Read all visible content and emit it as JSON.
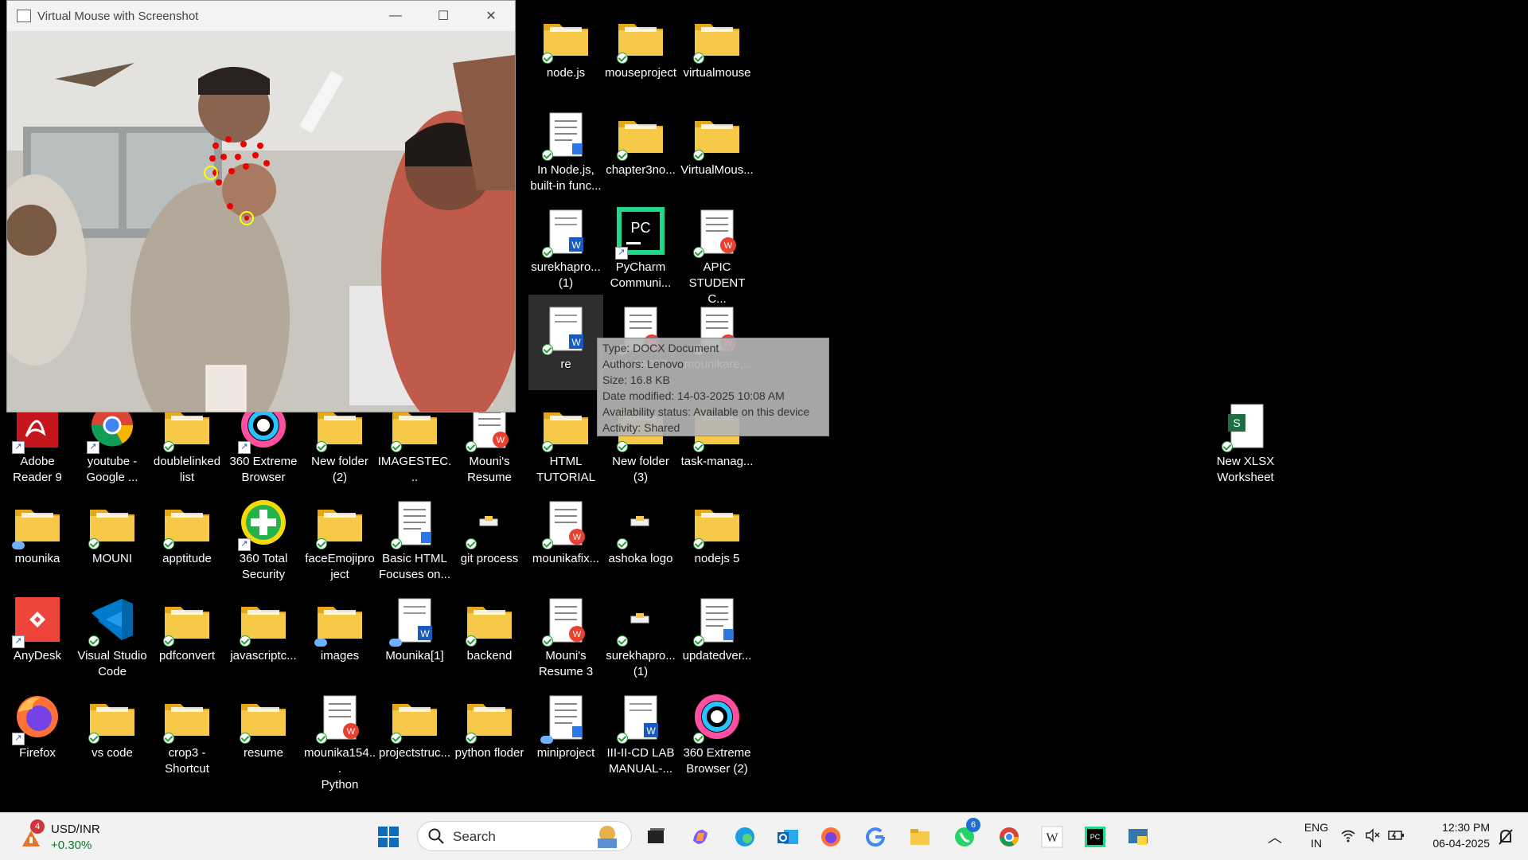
{
  "window": {
    "title": "Virtual Mouse with Screenshot",
    "minimize": "—",
    "maximize": "☐",
    "close": "✕"
  },
  "desktop_icons": [
    {
      "id": "nodejs",
      "label": "node.js",
      "type": "folder"
    },
    {
      "id": "mouseproject",
      "label": "mouseproject",
      "type": "folder"
    },
    {
      "id": "virtualmouse",
      "label": "virtualmouse",
      "type": "folder"
    },
    {
      "id": "innodejs",
      "label": "In Node.js,\nbuilt-in func...",
      "type": "doc"
    },
    {
      "id": "chapter3",
      "label": "chapter3no...",
      "type": "folder"
    },
    {
      "id": "virtualmous2",
      "label": "VirtualMous...",
      "type": "folder"
    },
    {
      "id": "surekha1",
      "label": "surekhapro...\n(1)",
      "type": "word"
    },
    {
      "id": "pycharm",
      "label": "PyCharm\nCommuni...",
      "type": "pycharm"
    },
    {
      "id": "apic",
      "label": "APIC\nSTUDENT C...",
      "type": "wps"
    },
    {
      "id": "re",
      "label": "re",
      "type": "word"
    },
    {
      "id": "r2221",
      "label": "2221 1A052...",
      "type": "wps"
    },
    {
      "id": "mounikare",
      "label": "mounikare...",
      "type": "wps"
    },
    {
      "id": "adobe",
      "label": "Adobe\nReader 9",
      "type": "adobe"
    },
    {
      "id": "youtube",
      "label": "youtube -\nGoogle ...",
      "type": "chrome"
    },
    {
      "id": "doublelinked",
      "label": "doublelinked\nlist",
      "type": "folder"
    },
    {
      "id": "extreme360",
      "label": "360 Extreme\nBrowser",
      "type": "ring"
    },
    {
      "id": "newfolder2",
      "label": "New folder\n(2)",
      "type": "folder"
    },
    {
      "id": "imagestec",
      "label": "IMAGESTEC...",
      "type": "folder"
    },
    {
      "id": "mounisresume",
      "label": "Mouni's\nResume",
      "type": "wps"
    },
    {
      "id": "htmltut",
      "label": "HTML\nTUTORIAL",
      "type": "folder"
    },
    {
      "id": "newfolder3",
      "label": "New folder\n(3)",
      "type": "folder"
    },
    {
      "id": "taskmanag",
      "label": "task-manag...",
      "type": "folder"
    },
    {
      "id": "newxlsx",
      "label": "New XLSX\nWorksheet",
      "type": "excel"
    },
    {
      "id": "mounika",
      "label": "mounika",
      "type": "folder"
    },
    {
      "id": "mouni",
      "label": "MOUNI",
      "type": "folder"
    },
    {
      "id": "apptitude",
      "label": "apptitude",
      "type": "folder"
    },
    {
      "id": "total360",
      "label": "360 Total\nSecurity",
      "type": "plus"
    },
    {
      "id": "faceemoji",
      "label": "faceEmojipro\nject",
      "type": "folder"
    },
    {
      "id": "basichtml",
      "label": "Basic HTML\nFocuses on...",
      "type": "doc"
    },
    {
      "id": "gitprocess",
      "label": "git process",
      "type": "small"
    },
    {
      "id": "mounikafix",
      "label": "mounikafix...",
      "type": "wps"
    },
    {
      "id": "ashoka",
      "label": "ashoka logo",
      "type": "small"
    },
    {
      "id": "nodejs5",
      "label": "nodejs 5",
      "type": "folder"
    },
    {
      "id": "anydesk",
      "label": "AnyDesk",
      "type": "anydesk"
    },
    {
      "id": "vscode",
      "label": "Visual Studio\nCode",
      "type": "vscode"
    },
    {
      "id": "pdfconvert",
      "label": "pdfconvert",
      "type": "folder"
    },
    {
      "id": "javascriptc",
      "label": "javascriptc...",
      "type": "folder"
    },
    {
      "id": "images",
      "label": "images",
      "type": "folder"
    },
    {
      "id": "mounika1",
      "label": "Mounika[1]",
      "type": "word"
    },
    {
      "id": "backend",
      "label": "backend",
      "type": "folder"
    },
    {
      "id": "mounisresume3",
      "label": "Mouni's\nResume 3",
      "type": "wps"
    },
    {
      "id": "surekha1b",
      "label": "surekhapro...\n(1)",
      "type": "small"
    },
    {
      "id": "updatedver",
      "label": "updatedver...",
      "type": "doc"
    },
    {
      "id": "firefox",
      "label": "Firefox",
      "type": "firefox"
    },
    {
      "id": "vscodefolder",
      "label": "vs code",
      "type": "folder"
    },
    {
      "id": "crop3",
      "label": "crop3 -\nShortcut",
      "type": "folder"
    },
    {
      "id": "resume",
      "label": "resume",
      "type": "folder"
    },
    {
      "id": "mounika154",
      "label": "mounika154...\nPython",
      "type": "wps"
    },
    {
      "id": "projectstruc",
      "label": "projectstruc...",
      "type": "folder"
    },
    {
      "id": "pythonfloder",
      "label": "python floder",
      "type": "folder"
    },
    {
      "id": "miniproject",
      "label": "miniproject",
      "type": "doc"
    },
    {
      "id": "labmanual",
      "label": "III-II-CD LAB\nMANUAL-...",
      "type": "word"
    },
    {
      "id": "extreme360b",
      "label": "360 Extreme\nBrowser (2)",
      "type": "ring"
    }
  ],
  "tooltip": {
    "type": "Type: DOCX Document",
    "authors": "Authors: Lenovo",
    "size": "Size: 16.8 KB",
    "modified": "Date modified: 14-03-2025 10:08 AM",
    "availability": "Availability status: Available on this device",
    "activity": "Activity: Shared"
  },
  "taskbar": {
    "weather_badge": "4",
    "ticker_name": "USD/INR",
    "ticker_change": "+0.30%",
    "search_placeholder": "Search",
    "whatsapp_badge": "6",
    "lang_top": "ENG",
    "lang_bottom": "IN",
    "time": "12:30 PM",
    "date": "06-04-2025"
  },
  "colors": {
    "folder": "#f7c948",
    "folder_dark": "#e6a817",
    "taskbar_bg": "#f2f2f2",
    "accent": "#0067c0",
    "wps_red": "#e8412f",
    "word_blue": "#185abd"
  }
}
